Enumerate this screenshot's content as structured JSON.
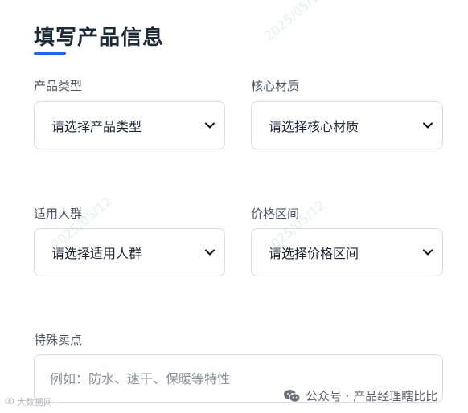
{
  "form": {
    "title": "填写产品信息",
    "product_type": {
      "label": "产品类型",
      "value": "请选择产品类型"
    },
    "core_material": {
      "label": "核心材质",
      "value": "请选择核心材质"
    },
    "target_audience": {
      "label": "适用人群",
      "value": "请选择适用人群"
    },
    "price_range": {
      "label": "价格区间",
      "value": "请选择价格区间"
    },
    "selling_points": {
      "label": "特殊卖点",
      "placeholder": "例如：防水、速干、保暖等特性"
    }
  },
  "watermark": {
    "footer_text": "公众号 · 产品经理瞎比比",
    "left_text": "大数据网",
    "diagonal_date": "2025/05/12"
  },
  "colors": {
    "accent": "#2563eb",
    "border": "#d9dde3",
    "label": "#4b5563"
  }
}
